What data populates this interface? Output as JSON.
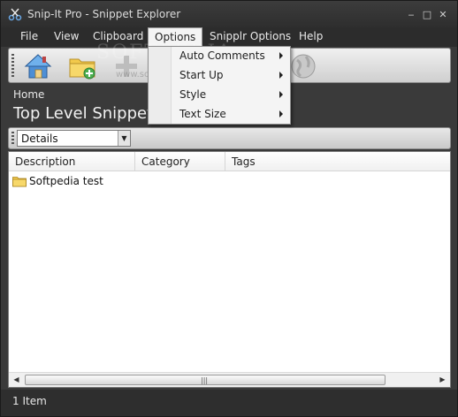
{
  "window": {
    "title": "Snip-It Pro - Snippet Explorer",
    "controls": {
      "minimize": "‒",
      "maximize": "□",
      "close": "✕"
    }
  },
  "menubar": {
    "items": [
      {
        "label": "File"
      },
      {
        "label": "View"
      },
      {
        "label": "Clipboard"
      },
      {
        "label": "Options"
      },
      {
        "label": "Snipplr Options"
      },
      {
        "label": "Help"
      }
    ]
  },
  "options_menu": {
    "items": [
      {
        "label": "Auto Comments",
        "submenu": true
      },
      {
        "label": "Start Up",
        "submenu": true
      },
      {
        "label": "Style",
        "submenu": true
      },
      {
        "label": "Text Size",
        "submenu": true
      }
    ]
  },
  "toolbar": {
    "buttons": [
      {
        "icon": "home-icon"
      },
      {
        "icon": "new-folder-icon"
      },
      {
        "icon": "add-icon"
      },
      {
        "icon": "globe-icon"
      }
    ]
  },
  "header": {
    "breadcrumb": "Home",
    "title": "Top Level Snippets"
  },
  "view_selector": {
    "selected": "Details"
  },
  "list": {
    "columns": [
      {
        "label": "Description"
      },
      {
        "label": "Category"
      },
      {
        "label": "Tags"
      }
    ],
    "rows": [
      {
        "description": "Softpedia test",
        "icon": "folder-icon"
      }
    ],
    "scrollbar_grip": "|||"
  },
  "status": {
    "text": "1 Item"
  },
  "watermark": {
    "text": "SOFTPEDIA",
    "url": "www.softpedia.com"
  },
  "colors": {
    "window_bg": "#3a3a3a",
    "menu_bg": "#2c2c2c",
    "folder": "#f2c94c"
  }
}
